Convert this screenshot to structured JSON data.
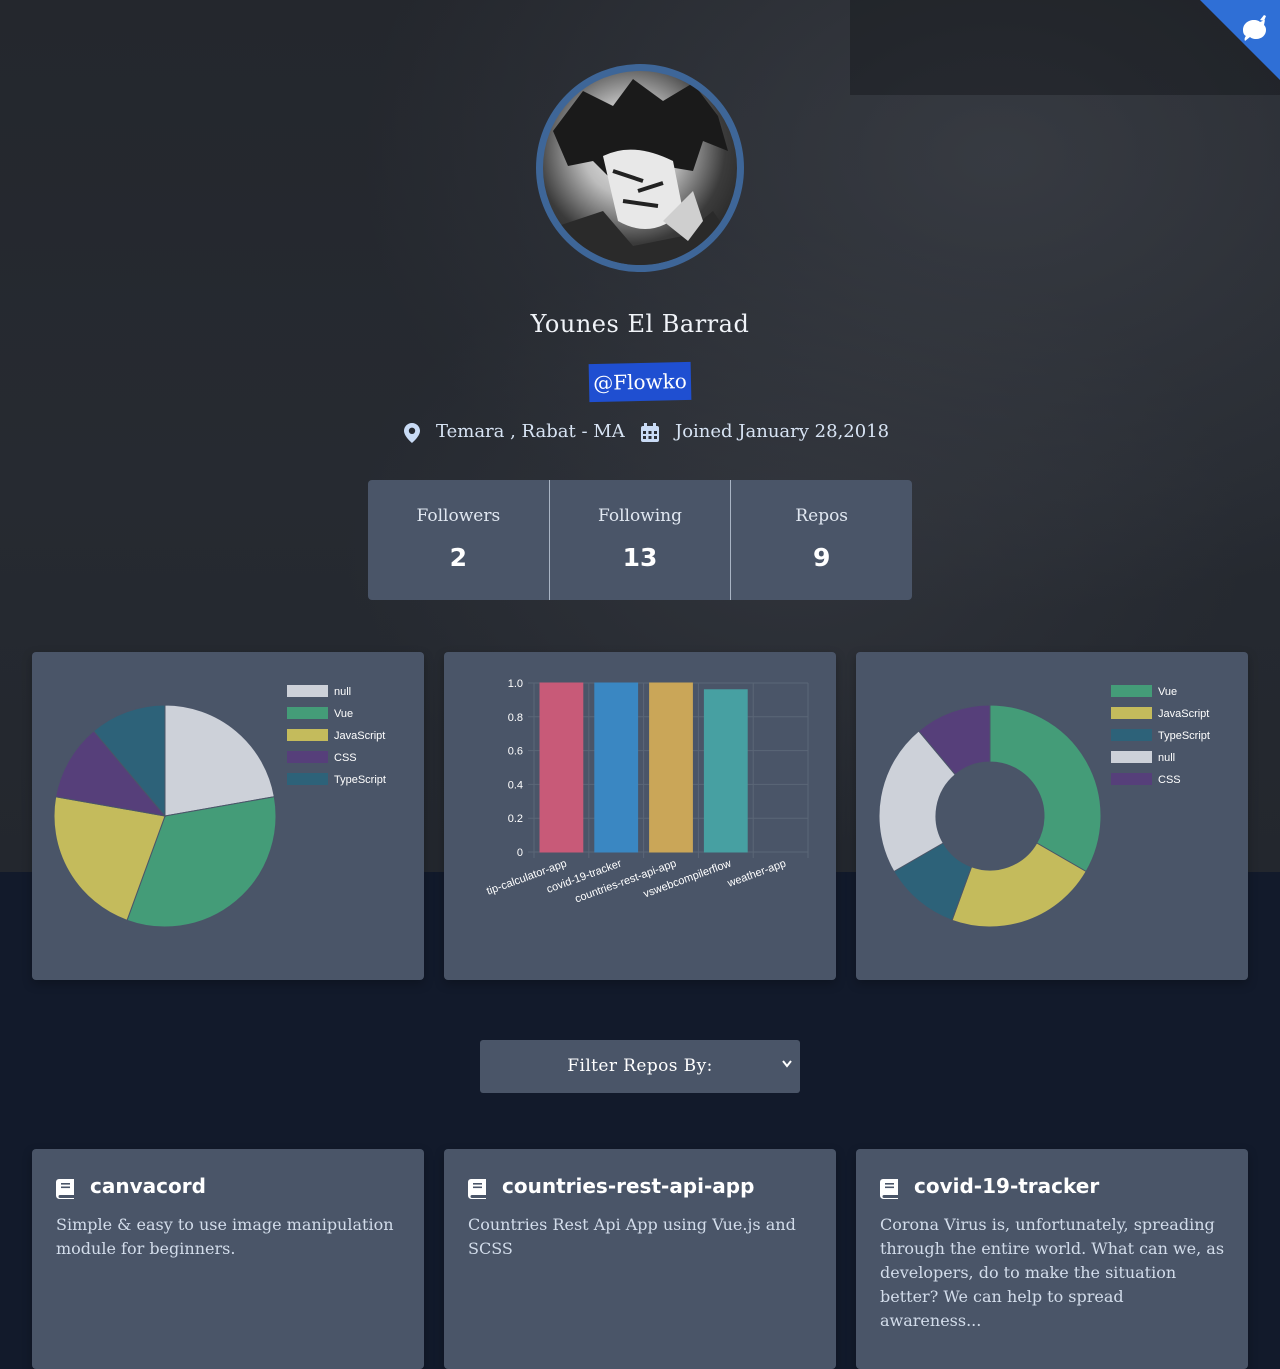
{
  "profile": {
    "name": "Younes El Barrad",
    "handle": "@Flowko",
    "location": "Temara , Rabat - MA",
    "joined": "Joined January 28,2018",
    "avatar_icon": "avatar-portrait",
    "location_icon": "map-pin-icon",
    "joined_icon": "calendar-icon"
  },
  "stats": {
    "followers": {
      "label": "Followers",
      "value": "2"
    },
    "following": {
      "label": "Following",
      "value": "13"
    },
    "repos": {
      "label": "Repos",
      "value": "9"
    }
  },
  "colors": {
    "page_bg": "#121a2b",
    "hero_bg": "#262a31",
    "card_bg": "#4a5568",
    "handle_bg": "#1f4fd1",
    "avatar_ring": "#3e6698",
    "corner": "#2f6fd6"
  },
  "corner_icon": "github-octocat-icon",
  "filter": {
    "label": "Filter Repos By:"
  },
  "repos": [
    {
      "title": "canvacord",
      "description": "Simple & easy to use image manipulation module for beginners."
    },
    {
      "title": "countries-rest-api-app",
      "description": "Countries Rest Api App using Vue.js and SCSS"
    },
    {
      "title": "covid-19-tracker",
      "description": "Corona Virus is, unfortunately, spreading through the entire world. What can we, as developers, do to make the situation better? We can help to spread awareness..."
    }
  ],
  "chart_data": [
    {
      "type": "pie",
      "legend_position": "top-right",
      "labels": [
        "null",
        "Vue",
        "JavaScript",
        "CSS",
        "TypeScript"
      ],
      "values": [
        2,
        3,
        2,
        1,
        1
      ],
      "colors": [
        "#cdd1d9",
        "#449c78",
        "#c4bb5c",
        "#563f7a",
        "#2d6279"
      ]
    },
    {
      "type": "bar",
      "categories": [
        "tip-calculator-app",
        "covid-19-tracker",
        "countries-rest-api-app",
        "vswebcompilerflow",
        "weather-app"
      ],
      "values": [
        1.0,
        1.0,
        1.0,
        0.96,
        0
      ],
      "ylim": [
        0,
        1.0
      ],
      "yticks": [
        "0",
        "0.2",
        "0.4",
        "0.6",
        "0.8",
        "1.0"
      ],
      "grid": true,
      "colors": [
        "#c85a78",
        "#3a87c2",
        "#caa658",
        "#47a0a2",
        "#6b7380"
      ]
    },
    {
      "type": "doughnut",
      "legend_position": "top-right",
      "labels": [
        "Vue",
        "JavaScript",
        "TypeScript",
        "null",
        "CSS"
      ],
      "values": [
        3,
        2,
        1,
        2,
        1
      ],
      "colors": [
        "#449c78",
        "#c4bb5c",
        "#2d6279",
        "#cdd1d9",
        "#563f7a"
      ]
    }
  ]
}
